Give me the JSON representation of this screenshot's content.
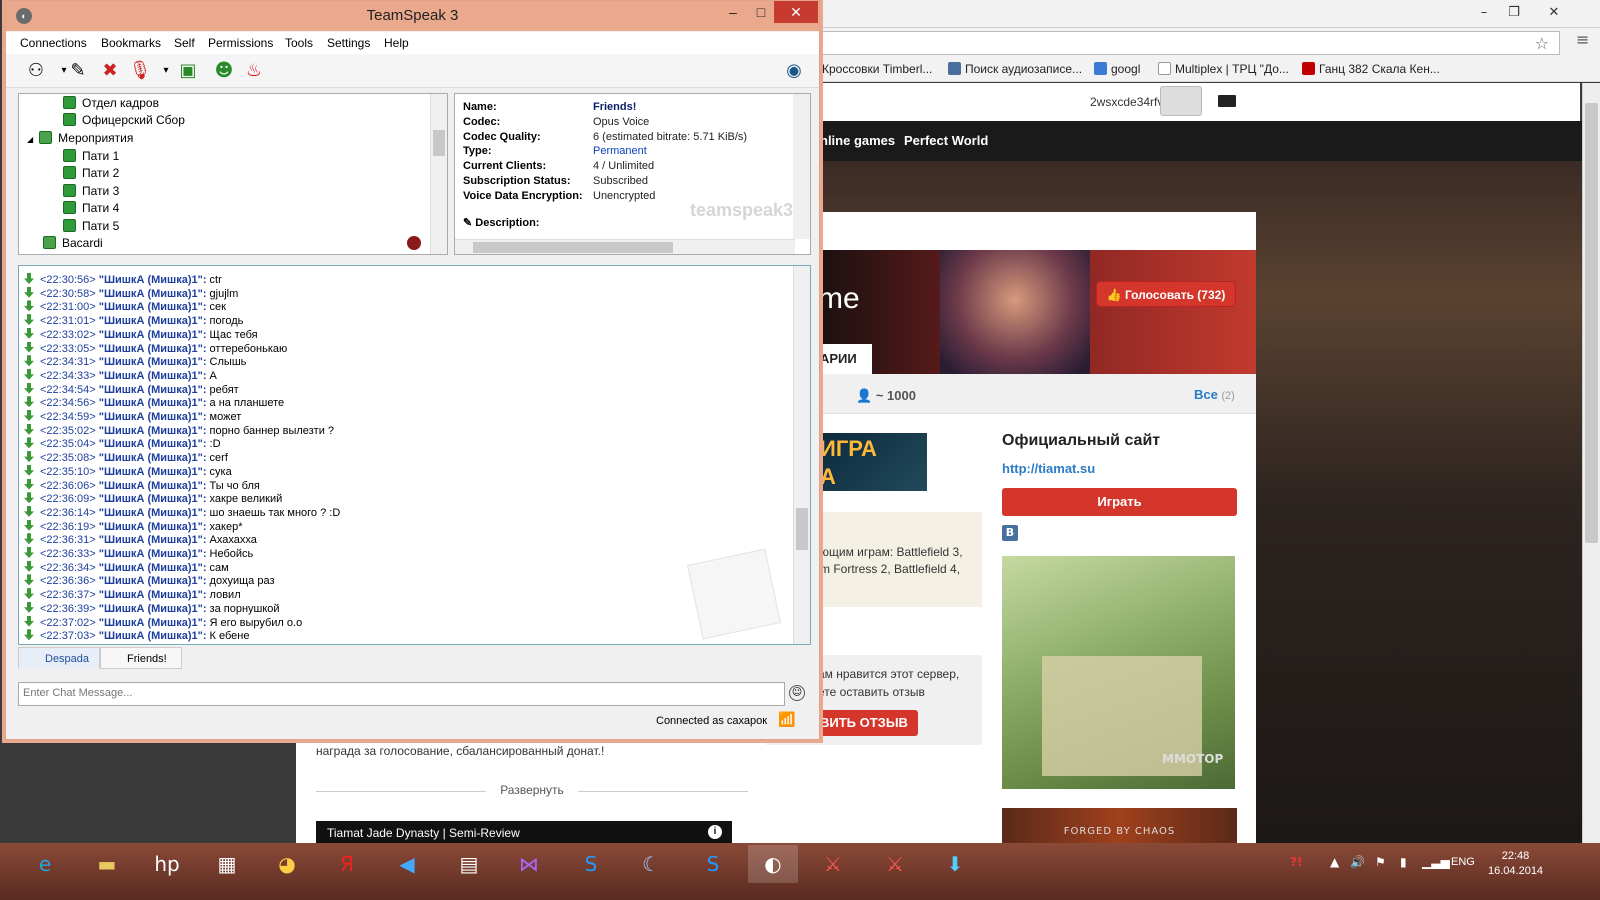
{
  "browser": {
    "bookmarks": [
      {
        "label": "Кроссовки Timberl...",
        "icon": "bookmark-page-icon",
        "color": "#f2f2f2"
      },
      {
        "label": "Поиск аудиозаписе...",
        "icon": "vk-icon",
        "color": "#4a6f9c"
      },
      {
        "label": "googl",
        "icon": "google-icon",
        "color": "#3a7bd5"
      },
      {
        "label": "Multiplex | ТРЦ \"До...",
        "icon": "page-icon",
        "color": "#f2f2f2"
      },
      {
        "label": "Ганц 382 Скала Кен...",
        "icon": "m-icon",
        "color": "#c00000"
      }
    ],
    "username": "2wsxcde34rfv",
    "nav": {
      "online_games": "nline games",
      "perfect_world": "Perfect World"
    },
    "banner_text": "me",
    "vote_button": "👍 Голосовать (732)",
    "comments_tab": "АРИИ",
    "online_count": "~ 1000",
    "all_label": "Все",
    "all_count": "(2)",
    "game_img_text": "ИГРА\nА",
    "tags_text": "ющим играм: Battlefield 3,\nm Fortress 2, Battlefield 4,",
    "review_text": "ам нравится этот сервер,\nете оставить отзыв",
    "review_button": "ВИТЬ ОТЗЫВ",
    "desc_text": "награда за голосование, сбалансированный донат.!",
    "expand": "Развернуть",
    "video_title": "Tiamat Jade Dynasty | Semi-Review",
    "official_site": "Официальный сайт",
    "site_link": "http://tiamat.su",
    "play_button": "Играть",
    "vk": "В",
    "forged_banner": "FORGED BY CHAOS",
    "mmotop": "MMOTOP"
  },
  "teamspeak": {
    "title": "TeamSpeak 3",
    "menu": [
      "Connections",
      "Bookmarks",
      "Self",
      "Permissions",
      "Tools",
      "Settings",
      "Help"
    ],
    "tree": [
      {
        "label": "Отдел кадров",
        "indent": 2
      },
      {
        "label": "Офицерский Сбор",
        "indent": 2
      },
      {
        "label": "Мероприятия",
        "indent": 1
      },
      {
        "label": "Пати 1",
        "indent": 2
      },
      {
        "label": "Пати 2",
        "indent": 2
      },
      {
        "label": "Пати 3",
        "indent": 2
      },
      {
        "label": "Пати 4",
        "indent": 2
      },
      {
        "label": "Пати 5",
        "indent": 2
      },
      {
        "label": "Bacardi",
        "indent": 1
      }
    ],
    "info": [
      {
        "key": "Name:",
        "value": "Friends!",
        "style": "bold"
      },
      {
        "key": "Codec:",
        "value": "Opus Voice",
        "style": ""
      },
      {
        "key": "Codec Quality:",
        "value": "6 (estimated bitrate: 5.71 KiB/s)",
        "style": ""
      },
      {
        "key": "Type:",
        "value": "Permanent",
        "style": "link"
      },
      {
        "key": "Current Clients:",
        "value": "4 / Unlimited",
        "style": ""
      },
      {
        "key": "Subscription Status:",
        "value": "Subscribed",
        "style": ""
      },
      {
        "key": "Voice Data Encryption:",
        "value": "Unencrypted",
        "style": ""
      }
    ],
    "description_label": "Description:",
    "watermark": "teamspeak3",
    "nick": "\"ШишкА (Мишка)1\":",
    "messages": [
      {
        "time": "<22:30:56>",
        "text": "ctr"
      },
      {
        "time": "<22:30:58>",
        "text": "gjujlm"
      },
      {
        "time": "<22:31:00>",
        "text": "сек"
      },
      {
        "time": "<22:31:01>",
        "text": "погодь"
      },
      {
        "time": "<22:33:02>",
        "text": "Щас тебя"
      },
      {
        "time": "<22:33:05>",
        "text": "оттеребонькаю"
      },
      {
        "time": "<22:34:31>",
        "text": "Слышь"
      },
      {
        "time": "<22:34:33>",
        "text": "А"
      },
      {
        "time": "<22:34:54>",
        "text": "ребят"
      },
      {
        "time": "<22:34:56>",
        "text": "а на планшете"
      },
      {
        "time": "<22:34:59>",
        "text": "может"
      },
      {
        "time": "<22:35:02>",
        "text": "порно баннер вылезти ?"
      },
      {
        "time": "<22:35:04>",
        "text": ":D"
      },
      {
        "time": "<22:35:08>",
        "text": "cerf"
      },
      {
        "time": "<22:35:10>",
        "text": "сука"
      },
      {
        "time": "<22:36:06>",
        "text": "Ты чо бля"
      },
      {
        "time": "<22:36:09>",
        "text": "хакре великий"
      },
      {
        "time": "<22:36:14>",
        "text": "шо знаешь так много ? :D"
      },
      {
        "time": "<22:36:19>",
        "text": "хакер*"
      },
      {
        "time": "<22:36:31>",
        "text": "Ахахахха"
      },
      {
        "time": "<22:36:33>",
        "text": "Небойсь"
      },
      {
        "time": "<22:36:34>",
        "text": "сам"
      },
      {
        "time": "<22:36:36>",
        "text": "дохуища раз"
      },
      {
        "time": "<22:36:37>",
        "text": "ловил"
      },
      {
        "time": "<22:36:39>",
        "text": "за порнушкой"
      },
      {
        "time": "<22:37:02>",
        "text": "Я его вырубил о.о"
      },
      {
        "time": "<22:37:03>",
        "text": "К ебене"
      }
    ],
    "tabs": [
      "Despada",
      "Friends!"
    ],
    "chat_placeholder": "Enter Chat Message...",
    "status": "Connected as сахарок"
  },
  "taskbar": {
    "lang": "ENG",
    "time": "22:48",
    "date": "16.04.2014"
  }
}
